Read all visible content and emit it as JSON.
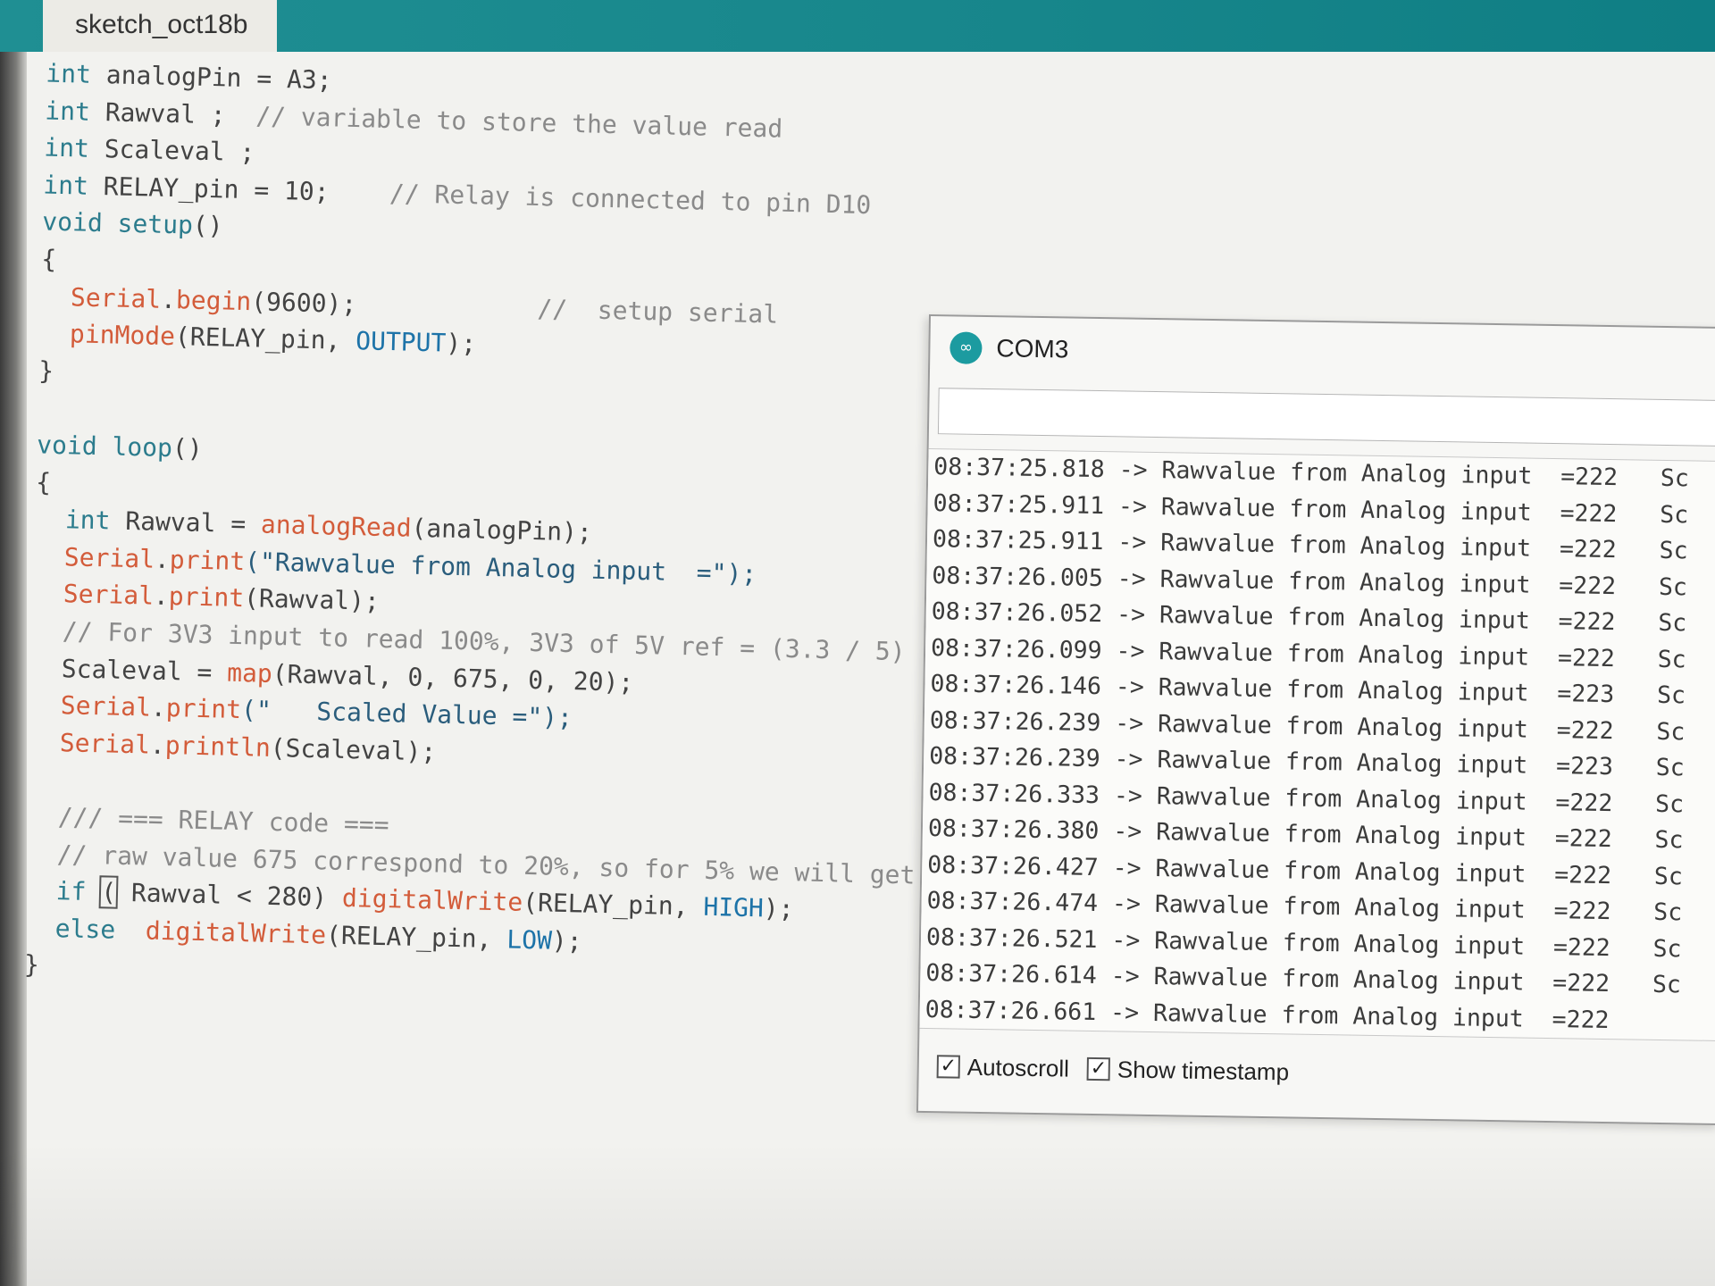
{
  "editor": {
    "tab_title": "sketch_oct18b",
    "code": [
      {
        "segs": [
          {
            "t": "int",
            "c": "kw"
          },
          {
            "t": " analogPin = A3;"
          }
        ]
      },
      {
        "segs": [
          {
            "t": "int",
            "c": "kw"
          },
          {
            "t": " Rawval ;  "
          },
          {
            "t": "// variable to store the value read",
            "c": "cm"
          }
        ]
      },
      {
        "segs": [
          {
            "t": "int",
            "c": "kw"
          },
          {
            "t": " Scaleval ;"
          }
        ]
      },
      {
        "segs": [
          {
            "t": "int",
            "c": "kw"
          },
          {
            "t": " RELAY_pin = 10;    "
          },
          {
            "t": "// Relay is connected to pin D10",
            "c": "cm"
          }
        ]
      },
      {
        "segs": [
          {
            "t": "void",
            "c": "kw"
          },
          {
            "t": " "
          },
          {
            "t": "setup",
            "c": "kw"
          },
          {
            "t": "()"
          }
        ]
      },
      {
        "segs": [
          {
            "t": "{"
          }
        ]
      },
      {
        "segs": [
          {
            "t": "  "
          },
          {
            "t": "Serial",
            "c": "fn"
          },
          {
            "t": "."
          },
          {
            "t": "begin",
            "c": "fn"
          },
          {
            "t": "(9600);            "
          },
          {
            "t": "//  setup serial",
            "c": "cm"
          }
        ]
      },
      {
        "segs": [
          {
            "t": "  "
          },
          {
            "t": "pinMode",
            "c": "fn"
          },
          {
            "t": "(RELAY_pin, "
          },
          {
            "t": "OUTPUT",
            "c": "cst"
          },
          {
            "t": ");"
          }
        ]
      },
      {
        "segs": [
          {
            "t": "}"
          }
        ]
      },
      {
        "segs": [
          {
            "t": ""
          }
        ]
      },
      {
        "segs": [
          {
            "t": "void",
            "c": "kw"
          },
          {
            "t": " "
          },
          {
            "t": "loop",
            "c": "kw"
          },
          {
            "t": "()"
          }
        ]
      },
      {
        "segs": [
          {
            "t": "{"
          }
        ]
      },
      {
        "segs": [
          {
            "t": "  "
          },
          {
            "t": "int",
            "c": "kw"
          },
          {
            "t": " Rawval = "
          },
          {
            "t": "analogRead",
            "c": "fn"
          },
          {
            "t": "(analogPin);"
          }
        ]
      },
      {
        "segs": [
          {
            "t": "  "
          },
          {
            "t": "Serial",
            "c": "fn"
          },
          {
            "t": "."
          },
          {
            "t": "print",
            "c": "fn"
          },
          {
            "t": "(\"Rawvalue from Analog input  =\");",
            "c": "st"
          }
        ]
      },
      {
        "segs": [
          {
            "t": "  "
          },
          {
            "t": "Serial",
            "c": "fn"
          },
          {
            "t": "."
          },
          {
            "t": "print",
            "c": "fn"
          },
          {
            "t": "(Rawval);"
          }
        ]
      },
      {
        "segs": [
          {
            "t": "  "
          },
          {
            "t": "// For 3V3 input to read 100%, 3V3 of 5V ref = (3.3 / 5)",
            "c": "cm"
          }
        ]
      },
      {
        "segs": [
          {
            "t": "  Scaleval = "
          },
          {
            "t": "map",
            "c": "fn"
          },
          {
            "t": "(Rawval, 0, 675, 0, 20);"
          }
        ]
      },
      {
        "segs": [
          {
            "t": "  "
          },
          {
            "t": "Serial",
            "c": "fn"
          },
          {
            "t": "."
          },
          {
            "t": "print",
            "c": "fn"
          },
          {
            "t": "(\"   Scaled Value =\");",
            "c": "st"
          }
        ]
      },
      {
        "segs": [
          {
            "t": "  "
          },
          {
            "t": "Serial",
            "c": "fn"
          },
          {
            "t": "."
          },
          {
            "t": "println",
            "c": "fn"
          },
          {
            "t": "(Scaleval);"
          }
        ]
      },
      {
        "segs": [
          {
            "t": ""
          }
        ]
      },
      {
        "segs": [
          {
            "t": "  "
          },
          {
            "t": "/// === RELAY code ===",
            "c": "cm"
          }
        ]
      },
      {
        "segs": [
          {
            "t": "  "
          },
          {
            "t": "// raw value 675 correspond to 20%, so for 5% we will get",
            "c": "cm"
          }
        ]
      },
      {
        "segs": [
          {
            "t": "  "
          },
          {
            "t": "if",
            "c": "kw"
          },
          {
            "t": " "
          },
          {
            "t": "(",
            "c": "cur"
          },
          {
            "t": " Rawval < 280) "
          },
          {
            "t": "digitalWrite",
            "c": "fn"
          },
          {
            "t": "(RELAY_pin, "
          },
          {
            "t": "HIGH",
            "c": "cst"
          },
          {
            "t": ");"
          }
        ]
      },
      {
        "segs": [
          {
            "t": "  "
          },
          {
            "t": "else",
            "c": "kw"
          },
          {
            "t": "  "
          },
          {
            "t": "digitalWrite",
            "c": "fn"
          },
          {
            "t": "(RELAY_pin, "
          },
          {
            "t": "LOW",
            "c": "cst"
          },
          {
            "t": ");"
          }
        ]
      },
      {
        "segs": [
          {
            "t": "}"
          }
        ]
      }
    ]
  },
  "serial_monitor": {
    "port_title": "COM3",
    "logo_glyph": "∞",
    "send_value": "",
    "lines": [
      "08:37:25.818 -> Rawvalue from Analog input  =222   Sc",
      "08:37:25.911 -> Rawvalue from Analog input  =222   Sc",
      "08:37:25.911 -> Rawvalue from Analog input  =222   Sc",
      "08:37:26.005 -> Rawvalue from Analog input  =222   Sc",
      "08:37:26.052 -> Rawvalue from Analog input  =222   Sc",
      "08:37:26.099 -> Rawvalue from Analog input  =222   Sc",
      "08:37:26.146 -> Rawvalue from Analog input  =223   Sc",
      "08:37:26.239 -> Rawvalue from Analog input  =222   Sc",
      "08:37:26.239 -> Rawvalue from Analog input  =223   Sc",
      "08:37:26.333 -> Rawvalue from Analog input  =222   Sc",
      "08:37:26.380 -> Rawvalue from Analog input  =222   Sc",
      "08:37:26.427 -> Rawvalue from Analog input  =222   Sc",
      "08:37:26.474 -> Rawvalue from Analog input  =222   Sc",
      "08:37:26.521 -> Rawvalue from Analog input  =222   Sc",
      "08:37:26.614 -> Rawvalue from Analog input  =222   Sc",
      "08:37:26.661 -> Rawvalue from Analog input  =222"
    ],
    "autoscroll_label": "Autoscroll",
    "autoscroll_checked": true,
    "timestamp_label": "Show timestamp",
    "timestamp_checked": true,
    "check_glyph": "✓"
  },
  "colors": {
    "teal_header": "#17868b",
    "keyword": "#2c7c8d",
    "function": "#d35c3a",
    "comment": "#8a8a8a"
  }
}
